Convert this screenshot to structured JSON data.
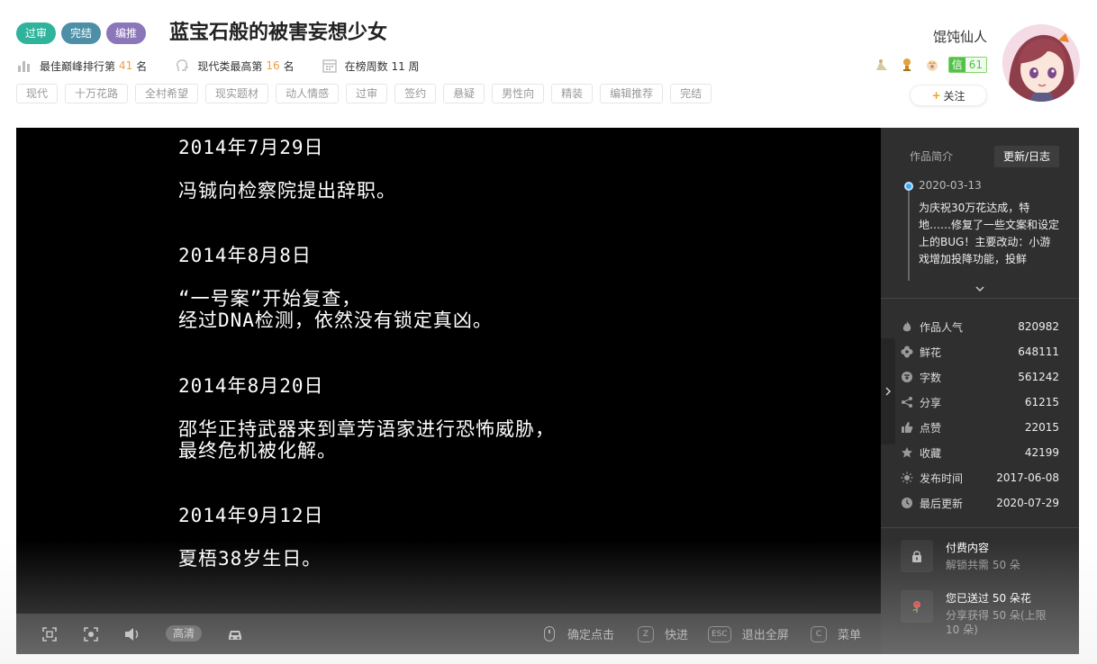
{
  "header": {
    "badges": [
      {
        "label": "过审",
        "color": "#2fb39a"
      },
      {
        "label": "完结",
        "color": "#4d8fa7"
      },
      {
        "label": "编推",
        "color": "#8a76b8"
      }
    ],
    "title": "蓝宝石般的被害妄想少女",
    "stats": {
      "peak_rank_prefix": "最佳巅峰排行第",
      "peak_rank_value": "41",
      "peak_rank_suffix": "名",
      "genre_rank_prefix": "现代类最高第",
      "genre_rank_value": "16",
      "genre_rank_suffix": "名",
      "weeks_label": "在榜周数 11 周"
    },
    "tags": [
      "现代",
      "十万花路",
      "全村希望",
      "现实题材",
      "动人情感",
      "过审",
      "签约",
      "悬疑",
      "男性向",
      "精装",
      "编辑推荐",
      "完结"
    ]
  },
  "author": {
    "name": "馄饨仙人",
    "medal_icons": [
      "flower-medal-icon",
      "trophy-medal-icon",
      "crown-medal-icon"
    ],
    "xin_label": "信",
    "xin_value": "61",
    "follow_label": "关注",
    "follow_plus": "+"
  },
  "game": {
    "entries": [
      {
        "date": "2014年7月29日",
        "lines": [
          "冯铖向检察院提出辞职。"
        ]
      },
      {
        "date": "2014年8月8日",
        "lines": [
          "“一号案”开始复查，",
          "经过DNA检测，依然没有锁定真凶。"
        ]
      },
      {
        "date": "2014年8月20日",
        "lines": [
          "邵华正持武器来到章芳语家进行恐怖威胁，",
          "最终危机被化解。"
        ]
      },
      {
        "date": "2014年9月12日",
        "lines": [
          "夏梧38岁生日。"
        ]
      }
    ]
  },
  "side": {
    "tabs": [
      {
        "label": "作品简介",
        "active": false
      },
      {
        "label": "更新/日志",
        "active": true
      }
    ],
    "log": {
      "date": "2020-03-13",
      "body": "为庆祝30万花达成，特地……修复了一些文案和设定上的BUG！主要改动：小游戏增加投降功能，投鲜"
    },
    "stats": [
      {
        "icon": "fire-icon",
        "label": "作品人气",
        "value": "820982"
      },
      {
        "icon": "flower-icon",
        "label": "鲜花",
        "value": "648111"
      },
      {
        "icon": "word-count-icon",
        "label": "字数",
        "value": "561242"
      },
      {
        "icon": "share-icon",
        "label": "分享",
        "value": "61215"
      },
      {
        "icon": "thumb-up-icon",
        "label": "点赞",
        "value": "22015"
      },
      {
        "icon": "star-icon",
        "label": "收藏",
        "value": "42199"
      },
      {
        "icon": "sun-icon",
        "label": "发布时间",
        "value": "2017-06-08"
      },
      {
        "icon": "clock-icon",
        "label": "最后更新",
        "value": "2020-07-29"
      }
    ],
    "paid": {
      "title": "付费内容",
      "sub": "解锁共需 50 朵"
    },
    "sent": {
      "title": "您已送过 50 朵花",
      "sub": "分享获得 50 朵(上限 10 朵)"
    }
  },
  "toolbar": {
    "quality": "高清",
    "hints": [
      {
        "key": "",
        "label": "确定点击",
        "type": "mouse"
      },
      {
        "key": "Z",
        "label": "快进",
        "type": "key"
      },
      {
        "key": "ESC",
        "label": "退出全屏",
        "type": "key"
      },
      {
        "key": "C",
        "label": "菜单",
        "type": "key"
      }
    ]
  }
}
